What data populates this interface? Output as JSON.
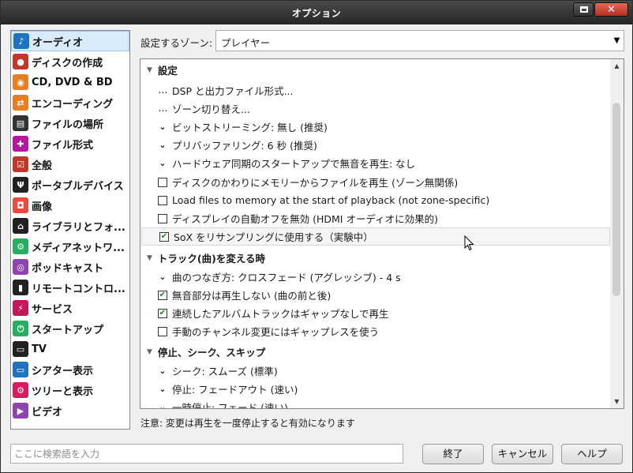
{
  "window": {
    "title": "オプション"
  },
  "sidebar": {
    "items": [
      {
        "label": "オーディオ",
        "icon": "music-note-icon",
        "glyph": "♪",
        "color": "#1e73be",
        "selected": true
      },
      {
        "label": "ディスクの作成",
        "icon": "disc-burn-icon",
        "glyph": "●",
        "color": "#c0392b"
      },
      {
        "label": "CD, DVD & BD",
        "icon": "disc-icon",
        "glyph": "◉",
        "color": "#e67e22"
      },
      {
        "label": "エンコーディング",
        "icon": "convert-arrows-icon",
        "glyph": "⇄",
        "color": "#e67e22"
      },
      {
        "label": "ファイルの場所",
        "icon": "folder-search-icon",
        "glyph": "▤",
        "color": "#333333"
      },
      {
        "label": "ファイル形式",
        "icon": "puzzle-icon",
        "glyph": "✚",
        "color": "#b5179e"
      },
      {
        "label": "全般",
        "icon": "checklist-icon",
        "glyph": "☑",
        "color": "#c0392b"
      },
      {
        "label": "ポータブルデバイス",
        "icon": "usb-icon",
        "glyph": "Ψ",
        "color": "#222222"
      },
      {
        "label": "画像",
        "icon": "camera-icon",
        "glyph": "◘",
        "color": "#e74c3c"
      },
      {
        "label": "ライブラリとフォ...",
        "icon": "house-icon",
        "glyph": "⌂",
        "color": "#222222"
      },
      {
        "label": "メディアネットワ...",
        "icon": "network-icon",
        "glyph": "⚙",
        "color": "#27ae60"
      },
      {
        "label": "ポッドキャスト",
        "icon": "podcast-icon",
        "glyph": "◎",
        "color": "#8e44ad"
      },
      {
        "label": "リモートコントロ...",
        "icon": "remote-icon",
        "glyph": "▮",
        "color": "#222222"
      },
      {
        "label": "サービス",
        "icon": "plug-icon",
        "glyph": "⚡",
        "color": "#c2185b"
      },
      {
        "label": "スタートアップ",
        "icon": "power-icon",
        "glyph": "⏻",
        "color": "#27ae60"
      },
      {
        "label": "TV",
        "icon": "tv-icon",
        "glyph": "▭",
        "color": "#222222"
      },
      {
        "label": "シアター表示",
        "icon": "monitor-icon",
        "glyph": "▭",
        "color": "#1e73be"
      },
      {
        "label": "ツリーと表示",
        "icon": "gear-icon",
        "glyph": "⚙",
        "color": "#d81b60"
      },
      {
        "label": "ビデオ",
        "icon": "film-icon",
        "glyph": "▶",
        "color": "#8e44ad"
      }
    ]
  },
  "zone": {
    "label": "設定するゾーン:",
    "value": "プレイヤー"
  },
  "settings": {
    "rows": [
      {
        "type": "header",
        "label": "設定"
      },
      {
        "type": "link",
        "label": "DSP と出力ファイル形式..."
      },
      {
        "type": "link",
        "label": "ゾーン切り替え..."
      },
      {
        "type": "dropdown",
        "label": "ビットストリーミング: 無し (推奨)"
      },
      {
        "type": "dropdown",
        "label": "プリバッファリング: 6 秒 (推奨)"
      },
      {
        "type": "dropdown",
        "label": "ハードウェア同期のスタートアップで無音を再生: なし"
      },
      {
        "type": "checkbox",
        "checked": false,
        "label": "ディスクのかわりにメモリーからファイルを再生 (ゾーン無関係)"
      },
      {
        "type": "checkbox",
        "checked": false,
        "label": "Load files to memory at the start of playback (not zone-specific)"
      },
      {
        "type": "checkbox",
        "checked": false,
        "label": "ディスプレイの自動オフを無効 (HDMI オーディオに効果的)"
      },
      {
        "type": "checkbox",
        "checked": true,
        "hover": true,
        "label": "SoX をリサンプリングに使用する（実験中）"
      },
      {
        "type": "header",
        "label": "トラック(曲)を変える時"
      },
      {
        "type": "dropdown",
        "label": "曲のつなぎ方: クロスフェード (アグレッシブ) - 4 s"
      },
      {
        "type": "checkbox",
        "checked": true,
        "label": "無音部分は再生しない (曲の前と後)"
      },
      {
        "type": "checkbox",
        "checked": true,
        "label": "連続したアルバムトラックはギャップなしで再生"
      },
      {
        "type": "checkbox",
        "checked": false,
        "label": "手動のチャンネル変更にはギャップレスを使う"
      },
      {
        "type": "header",
        "label": "停止、シーク、スキップ"
      },
      {
        "type": "dropdown",
        "label": "シーク: スムーズ (標準)"
      },
      {
        "type": "dropdown",
        "label": "停止: フェードアウト (速い)"
      },
      {
        "type": "dropdown",
        "label": "一時停止: フェード (速い)"
      }
    ]
  },
  "note": "注意: 変更は再生を一度停止すると有効になります",
  "search": {
    "placeholder": "ここに検索語を入力"
  },
  "buttons": {
    "ok": "終了",
    "cancel": "キャンセル",
    "help": "ヘルプ"
  }
}
